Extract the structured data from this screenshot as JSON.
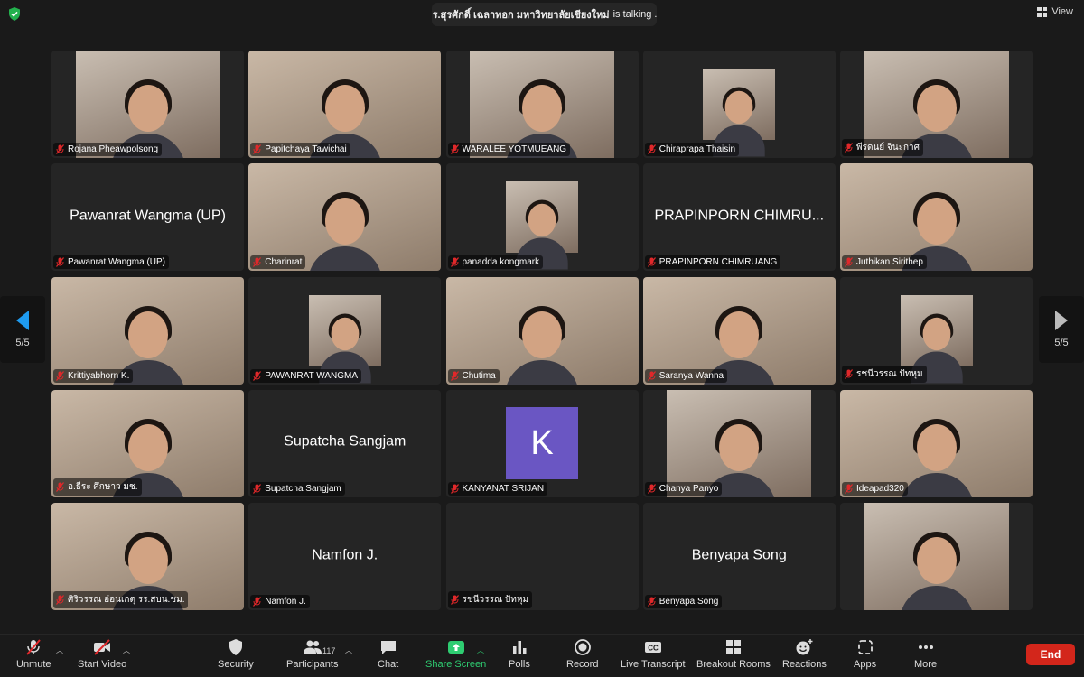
{
  "meeting": {
    "speaker_name": "ดร.สุรศักดิ์ เฉลาทอก มหาวิทยาลัยเชียงใหม่",
    "speaker_suffix": "is talking ...",
    "view_label": "View",
    "page_indicator_left": "5/5",
    "page_indicator_right": "5/5"
  },
  "colors": {
    "accent": "#1e9bf0",
    "end": "#d3261b",
    "share": "#2ecc71",
    "muted_mic": "#e0282a"
  },
  "participants": [
    {
      "name": "Rojana Pheawpolsong",
      "display": "video-box"
    },
    {
      "name": "Papitchaya Tawichai",
      "display": "full-video"
    },
    {
      "name": "WARALEE YOTMUEANG",
      "display": "video-box"
    },
    {
      "name": "Chiraprapa Thaisin",
      "display": "video-box-small"
    },
    {
      "name": "พีรดนย์ จินะกาศ",
      "display": "video-box"
    },
    {
      "name": "Pawanrat Wangma (UP)",
      "display": "name",
      "center": "Pawanrat Wangma (UP)"
    },
    {
      "name": "Charinrat",
      "display": "full-video"
    },
    {
      "name": "panadda kongmark",
      "display": "video-box-small"
    },
    {
      "name": "PRAPINPORN CHIMRUANG",
      "display": "name",
      "center": "PRAPINPORN CHIMRU..."
    },
    {
      "name": "Juthikan Sirithep",
      "display": "full-video"
    },
    {
      "name": "Krittiyabhorn K.",
      "display": "full-video"
    },
    {
      "name": "PAWANRAT WANGMA",
      "display": "video-box-small"
    },
    {
      "name": "Chutima",
      "display": "full-video"
    },
    {
      "name": "Saranya Wanna",
      "display": "full-video"
    },
    {
      "name": "รชนีวรรณ ปัทหุม",
      "display": "video-box-small"
    },
    {
      "name": "อ.ธีระ ศึกษาว มช.",
      "display": "full-video"
    },
    {
      "name": "Supatcha Sangjam",
      "display": "name",
      "center": "Supatcha Sangjam"
    },
    {
      "name": "KANYANAT SRIJAN",
      "display": "avatar",
      "initial": "K"
    },
    {
      "name": "Chanya Panyo",
      "display": "video-box"
    },
    {
      "name": "Ideapad320",
      "display": "full-video"
    },
    {
      "name": "ศิริวรรณ อ่อนเกตุ รร.สบน.ชม.",
      "display": "full-video"
    },
    {
      "name": "Namfon J.",
      "display": "name",
      "center": "Namfon J."
    },
    {
      "name": "รชนีวรรณ ปัทหุม",
      "display": "blank"
    },
    {
      "name": "Benyapa Song",
      "display": "name",
      "center": "Benyapa Song"
    },
    {
      "name": "",
      "display": "video-box"
    }
  ],
  "toolbar": {
    "unmute": "Unmute",
    "start_video": "Start Video",
    "security": "Security",
    "participants": "Participants",
    "participants_count": "117",
    "chat": "Chat",
    "share_screen": "Share Screen",
    "polls": "Polls",
    "record": "Record",
    "live_transcript": "Live Transcript",
    "breakout_rooms": "Breakout Rooms",
    "reactions": "Reactions",
    "apps": "Apps",
    "more": "More",
    "end": "End"
  }
}
